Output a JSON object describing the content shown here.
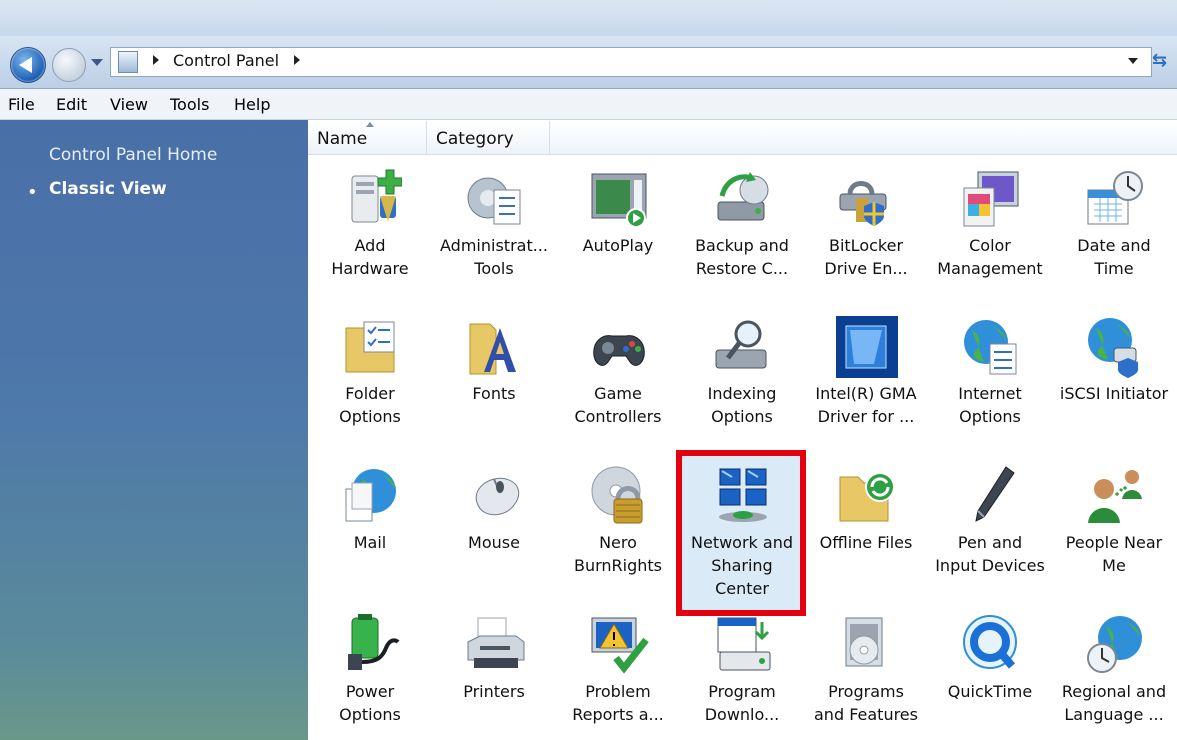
{
  "address": {
    "path_label": "Control Panel"
  },
  "menu": [
    "File",
    "Edit",
    "View",
    "Tools",
    "Help"
  ],
  "sidebar": {
    "home_label": "Control Panel Home",
    "classic_label": "Classic View"
  },
  "columns": {
    "name": "Name",
    "category": "Category"
  },
  "items": [
    {
      "label": "Add\nHardware",
      "icon": "add-hardware-icon"
    },
    {
      "label": "Administrat...\nTools",
      "icon": "administrative-tools-icon"
    },
    {
      "label": "AutoPlay",
      "icon": "autoplay-icon"
    },
    {
      "label": "Backup and\nRestore C...",
      "icon": "backup-restore-icon"
    },
    {
      "label": "BitLocker\nDrive En...",
      "icon": "bitlocker-icon"
    },
    {
      "label": "Color\nManagement",
      "icon": "color-management-icon"
    },
    {
      "label": "Date and\nTime",
      "icon": "date-time-icon"
    },
    {
      "label": "Folder\nOptions",
      "icon": "folder-options-icon"
    },
    {
      "label": "Fonts",
      "icon": "fonts-icon"
    },
    {
      "label": "Game\nControllers",
      "icon": "game-controller-icon"
    },
    {
      "label": "Indexing\nOptions",
      "icon": "indexing-options-icon"
    },
    {
      "label": "Intel(R) GMA\nDriver for ...",
      "icon": "intel-gma-icon"
    },
    {
      "label": "Internet\nOptions",
      "icon": "internet-options-icon"
    },
    {
      "label": "iSCSI Initiator",
      "icon": "iscsi-initiator-icon"
    },
    {
      "label": "Mail",
      "icon": "mail-icon"
    },
    {
      "label": "Mouse",
      "icon": "mouse-icon"
    },
    {
      "label": "Nero\nBurnRights",
      "icon": "nero-burnrights-icon"
    },
    {
      "label": "Network and\nSharing\nCenter",
      "icon": "network-sharing-icon"
    },
    {
      "label": "Offline Files",
      "icon": "offline-files-icon"
    },
    {
      "label": "Pen and\nInput Devices",
      "icon": "pen-input-icon"
    },
    {
      "label": "People Near\nMe",
      "icon": "people-near-me-icon"
    },
    {
      "label": "Power\nOptions",
      "icon": "power-options-icon"
    },
    {
      "label": "Printers",
      "icon": "printers-icon"
    },
    {
      "label": "Problem\nReports a...",
      "icon": "problem-reports-icon"
    },
    {
      "label": "Program\nDownlo...",
      "icon": "program-download-icon"
    },
    {
      "label": "Programs\nand Features",
      "icon": "programs-features-icon"
    },
    {
      "label": "QuickTime",
      "icon": "quicktime-icon"
    },
    {
      "label": "Regional and\nLanguage ...",
      "icon": "regional-language-icon"
    }
  ],
  "selected_item": "Network and\nSharing\nCenter",
  "colors": {
    "highlight_border": "#e3000f",
    "sidebar_top": "#4a6fa8",
    "sidebar_bottom": "#6a9888"
  }
}
